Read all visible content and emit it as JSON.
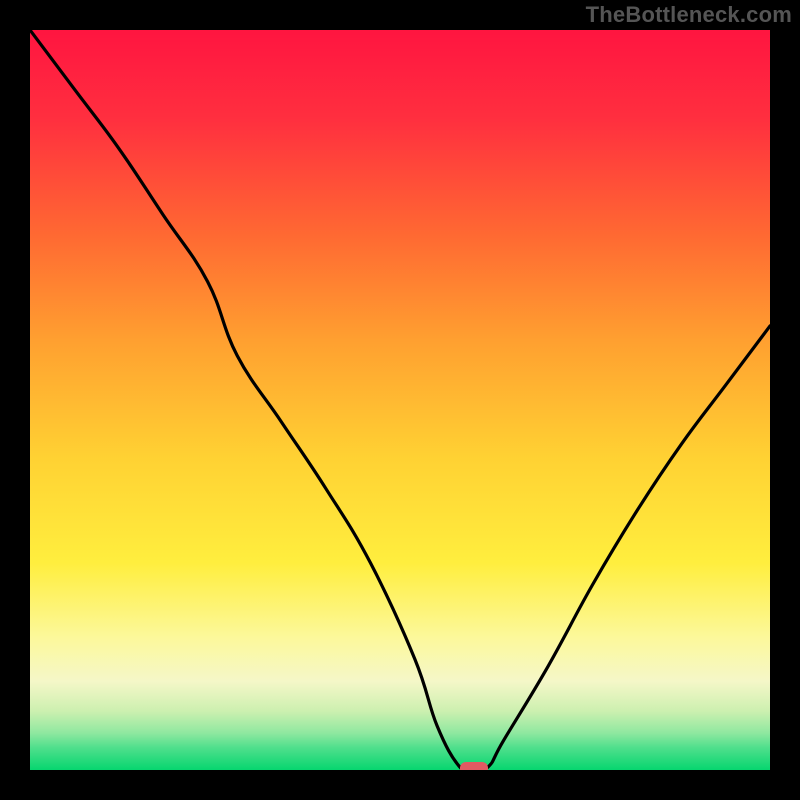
{
  "watermark": "TheBottleneck.com",
  "colors": {
    "black": "#000000",
    "red_top": "#ff1540",
    "orange": "#ff8a2a",
    "yellow": "#ffe63a",
    "pale_yellow": "#fbf8b0",
    "cream": "#f6f8d0",
    "green_light": "#6fe89a",
    "green": "#06d66f",
    "marker": "#e25a62",
    "curve": "#000000"
  },
  "chart_data": {
    "type": "line",
    "title": "",
    "xlabel": "",
    "ylabel": "",
    "xlim": [
      0,
      100
    ],
    "ylim": [
      0,
      100
    ],
    "series": [
      {
        "name": "bottleneck-curve",
        "x": [
          0,
          6,
          12,
          18,
          24,
          28,
          34,
          40,
          46,
          52,
          55,
          58,
          60,
          62,
          64,
          70,
          76,
          82,
          88,
          94,
          100
        ],
        "y": [
          100,
          92,
          84,
          75,
          66,
          56,
          47,
          38,
          28,
          15,
          6,
          0.5,
          0,
          0.5,
          4,
          14,
          25,
          35,
          44,
          52,
          60
        ]
      }
    ],
    "marker": {
      "x": 60,
      "y": 0,
      "shape": "pill"
    },
    "notes": "Background is a vertical rainbow gradient from red at top through orange/yellow to green at bottom, inside a black border. Curve is a black V-shaped line touching the bottom near x≈60. Y values estimated as percent of plot height from bottom."
  }
}
